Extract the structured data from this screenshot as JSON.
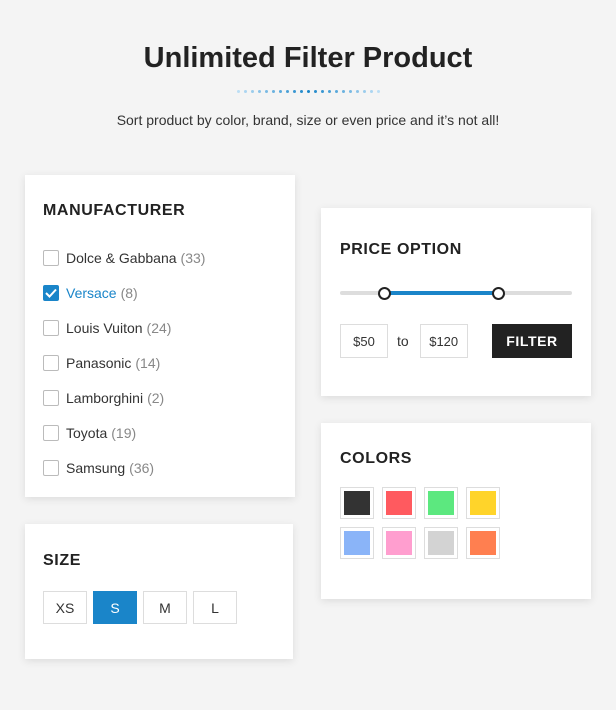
{
  "header": {
    "title": "Unlimited Filter Product",
    "subtitle": "Sort product by color, brand, size or even price and it’s not all!"
  },
  "manufacturer": {
    "title": "MANUFACTURER",
    "items": [
      {
        "label": "Dolce & Gabbana",
        "count": "(33)",
        "checked": false
      },
      {
        "label": "Versace",
        "count": "(8)",
        "checked": true
      },
      {
        "label": "Louis Vuiton",
        "count": "(24)",
        "checked": false
      },
      {
        "label": "Panasonic",
        "count": "(14)",
        "checked": false
      },
      {
        "label": "Lamborghini",
        "count": "(2)",
        "checked": false
      },
      {
        "label": "Toyota",
        "count": "(19)",
        "checked": false
      },
      {
        "label": "Samsung",
        "count": "(36)",
        "checked": false
      }
    ]
  },
  "size": {
    "title": "SIZE",
    "options": [
      {
        "label": "XS",
        "selected": false
      },
      {
        "label": "S",
        "selected": true
      },
      {
        "label": "M",
        "selected": false
      },
      {
        "label": "L",
        "selected": false
      }
    ]
  },
  "price": {
    "title": "PRICE OPTION",
    "slider_min_fraction": 0.19,
    "slider_max_fraction": 0.68,
    "min_value": "$50",
    "max_value": "$120",
    "to_label": "to",
    "filter_label": "FILTER"
  },
  "colors": {
    "title": "COLORS",
    "swatches": [
      "#333333",
      "#ff5a5f",
      "#5ce87f",
      "#ffd42a",
      "#8ab4f8",
      "#ff9ecf",
      "#d3d3d3",
      "#ff7f50"
    ]
  },
  "theme": {
    "accent": "#1a85c9",
    "dark": "#222222"
  }
}
